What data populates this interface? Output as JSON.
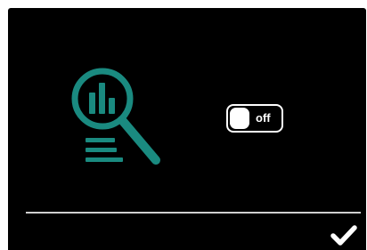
{
  "toggle": {
    "state_label": "off",
    "is_on": false
  },
  "colors": {
    "background": "#000000",
    "accent": "#1a8a80",
    "foreground": "#ffffff",
    "divider": "#cfcfcf"
  },
  "icons": {
    "main": "analytics-search-icon",
    "confirm": "checkmark-icon"
  }
}
